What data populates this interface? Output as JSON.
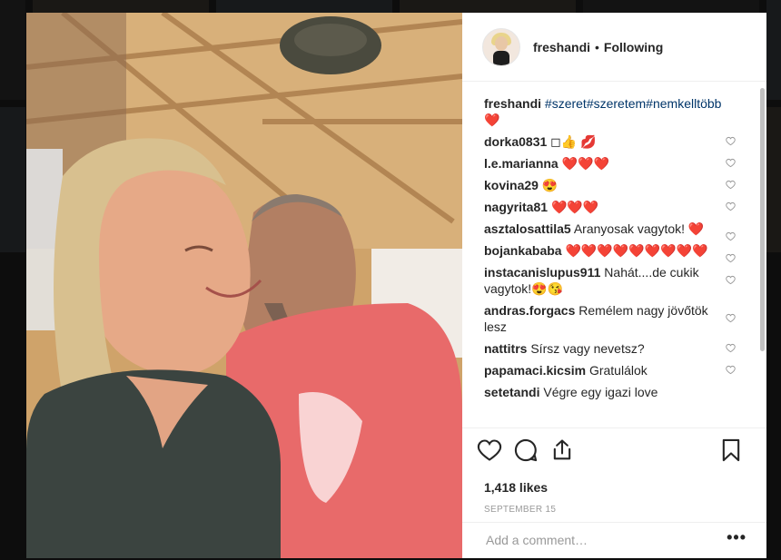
{
  "post": {
    "username": "freshandi",
    "follow_separator": "•",
    "follow_status": "Following"
  },
  "caption": {
    "username": "freshandi",
    "hashtags": "#szeret#szeretem#nemkelltöbb",
    "emoji": "❤️"
  },
  "comments": [
    {
      "username": "dorka0831",
      "text": "◻👍 💋"
    },
    {
      "username": "l.e.marianna",
      "text": "❤️❤️❤️"
    },
    {
      "username": "kovina29",
      "text": "😍"
    },
    {
      "username": "nagyrita81",
      "text": "❤️❤️❤️"
    },
    {
      "username": "asztalosattila5",
      "text": "Aranyosak vagytok! ❤️"
    },
    {
      "username": "bojankababa",
      "text": "❤️❤️❤️❤️❤️❤️❤️❤️❤️"
    },
    {
      "username": "instacanislupus911",
      "text": "Nahát....de cukik vagytok!😍😘"
    },
    {
      "username": "andras.forgacs",
      "text": "Remélem nagy jövőtök lesz"
    },
    {
      "username": "nattitrs",
      "text": "Sírsz vagy nevetsz?"
    },
    {
      "username": "papamaci.kicsim",
      "text": "Gratulálok"
    },
    {
      "username": "setetandi",
      "text": "Végre egy igazi love"
    }
  ],
  "actions": {
    "like_icon": "heart-outline-icon",
    "comment_icon": "comment-bubble-icon",
    "share_icon": "share-icon",
    "save_icon": "bookmark-icon"
  },
  "likes_text": "1,418 likes",
  "date_text": "SEPTEMBER 15",
  "comment_input": {
    "placeholder": "Add a comment…"
  },
  "more_options": "•••",
  "colors": {
    "heart_red": "#e0262f",
    "hashtag_blue": "#003569",
    "text_dark": "#262626",
    "text_muted": "#999999"
  }
}
